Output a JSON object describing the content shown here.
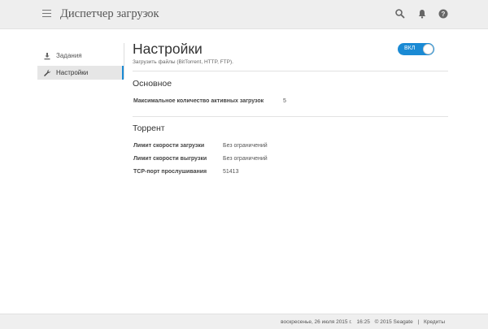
{
  "header": {
    "title": "Диспетчер загрузок",
    "icons": [
      "menu-icon",
      "chevron-down-icon",
      "search-icon",
      "bell-icon",
      "help-icon"
    ]
  },
  "sidebar": {
    "items": [
      {
        "label": "Задания",
        "icon": "download-icon",
        "active": false
      },
      {
        "label": "Настройки",
        "icon": "wrench-icon",
        "active": true
      }
    ]
  },
  "main": {
    "title": "Настройки",
    "subtitle": "Загрузить файлы (BitTorrent, HTTP, FTP).",
    "toggle": {
      "label": "ВКЛ",
      "on": true
    },
    "sections": [
      {
        "title": "Основное",
        "rows": [
          {
            "label": "Максимальное количество активных загрузок",
            "value": "5"
          }
        ]
      },
      {
        "title": "Торрент",
        "rows": [
          {
            "label": "Лимит скорости загрузки",
            "value": "Без ограничений"
          },
          {
            "label": "Лимит скорости выгрузки",
            "value": "Без ограничений"
          },
          {
            "label": "TCP-порт прослушивания",
            "value": "51413"
          }
        ]
      }
    ]
  },
  "footer": {
    "date": "воскресенье, 26 июля 2015 г.",
    "time": "16:25",
    "copyright": "© 2015 Seagate",
    "separator": "|",
    "credits": "Кредиты"
  },
  "colors": {
    "accent": "#1a8ad4",
    "topbar": "#eeeeee",
    "footer": "#efefef"
  }
}
